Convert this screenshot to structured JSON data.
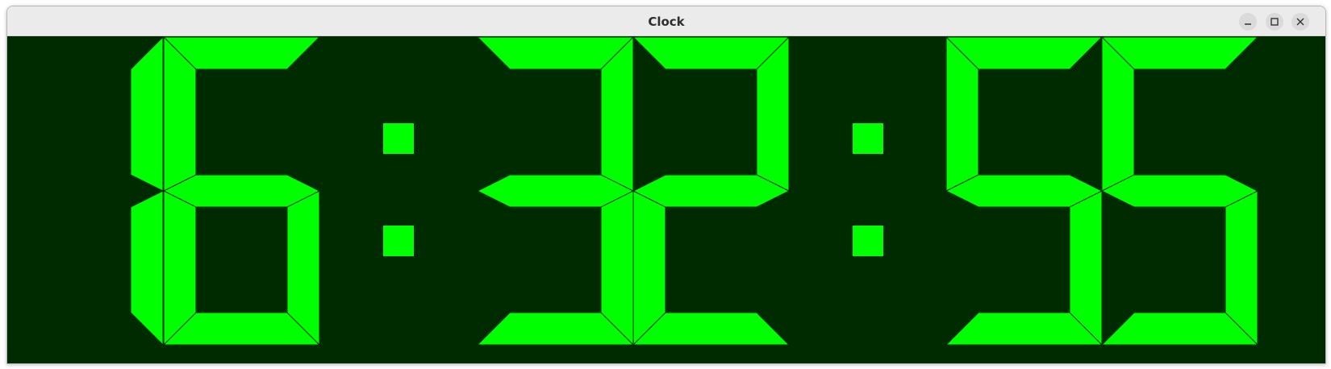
{
  "window": {
    "title": "Clock",
    "controls": {
      "minimize": "minimize-icon",
      "maximize": "maximize-icon",
      "close": "close-icon"
    }
  },
  "clock": {
    "time": "16:32:55",
    "colors": {
      "background": "#002b00",
      "segment_on": "#00ff00",
      "segment_outline": "#003300"
    }
  }
}
